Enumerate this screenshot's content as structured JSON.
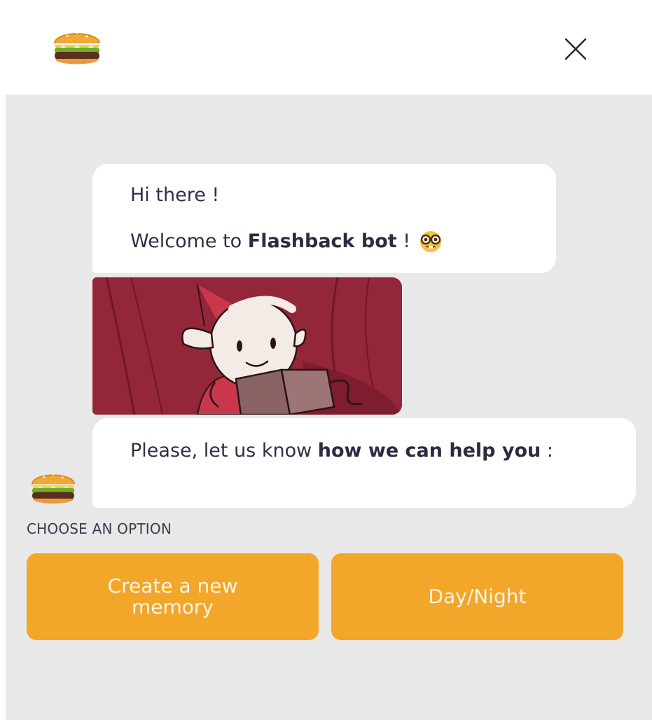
{
  "header": {
    "logo_icon": "burger-icon",
    "close_icon": "close-icon"
  },
  "messages": {
    "greeting": "Hi there !",
    "welcome_prefix": "Welcome to ",
    "welcome_bot_name": "Flashback bot",
    "welcome_suffix": " !",
    "welcome_emoji": "nerd-face-icon",
    "illustration": "gnome-reading-book-illustration",
    "help_prefix": "Please, let us know ",
    "help_bold": "how we can help you",
    "help_suffix": " :"
  },
  "options": {
    "label": "CHOOSE AN OPTION",
    "items": [
      {
        "label": "Create a new memory"
      },
      {
        "label": "Day/Night"
      }
    ]
  },
  "colors": {
    "accent": "#f2a62a",
    "chat_background": "#e8e8e8",
    "bubble": "#ffffff",
    "text": "#2e3046"
  }
}
